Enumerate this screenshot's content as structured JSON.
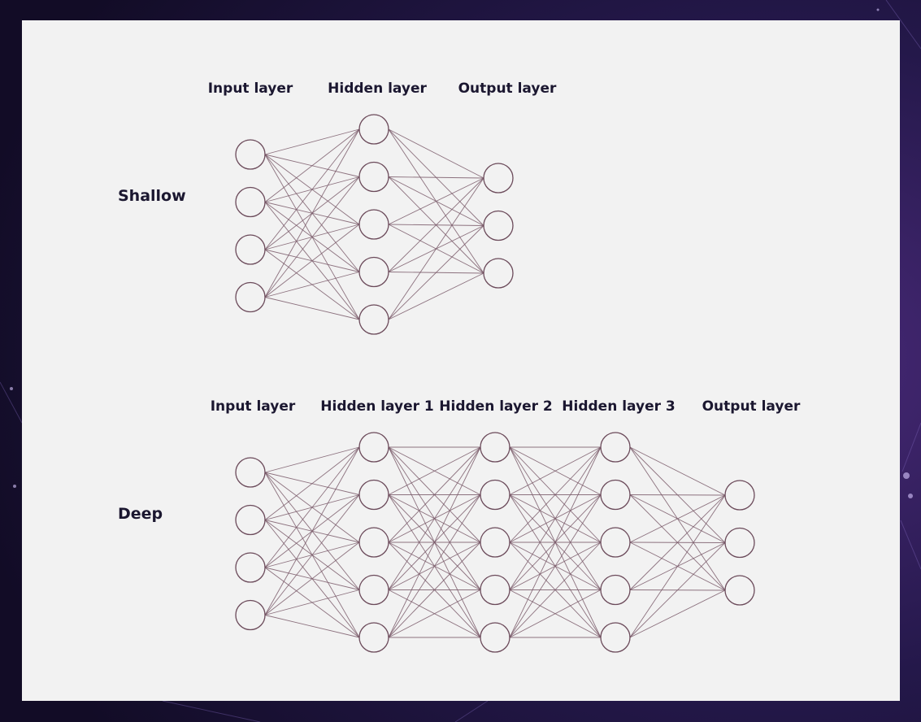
{
  "colors": {
    "background": "#1c1436",
    "panel": "#f2f2f2",
    "node_stroke": "#6b4a5a",
    "edge_stroke": "#7a5b6a",
    "text": "#1b1730"
  },
  "diagrams": [
    {
      "id": "shallow",
      "section_label": "Shallow",
      "layers": [
        {
          "label": "Input layer",
          "nodes": 4
        },
        {
          "label": "Hidden layer",
          "nodes": 5
        },
        {
          "label": "Output layer",
          "nodes": 3
        }
      ]
    },
    {
      "id": "deep",
      "section_label": "Deep",
      "layers": [
        {
          "label": "Input layer",
          "nodes": 4
        },
        {
          "label": "Hidden layer 1",
          "nodes": 5
        },
        {
          "label": "Hidden layer 2",
          "nodes": 5
        },
        {
          "label": "Hidden layer 3",
          "nodes": 5
        },
        {
          "label": "Output layer",
          "nodes": 3
        }
      ]
    }
  ]
}
